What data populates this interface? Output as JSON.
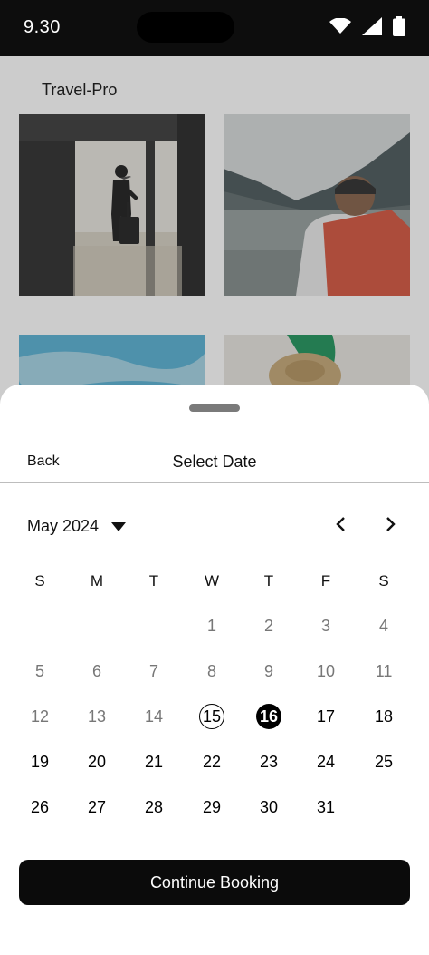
{
  "status_bar": {
    "time": "9.30",
    "icons": [
      "wifi-icon",
      "cellular-signal-icon",
      "battery-icon"
    ]
  },
  "background_app": {
    "title": "Travel-Pro",
    "photos": [
      "traveler-with-suitcase-silhouette",
      "hiker-with-backpack-lake",
      "blue-sky",
      "straw-hat-with-leaf"
    ]
  },
  "sheet": {
    "back_label": "Back",
    "title": "Select Date",
    "month_label": "May 2024",
    "weekdays": [
      "S",
      "M",
      "T",
      "W",
      "T",
      "F",
      "S"
    ],
    "weeks": [
      [
        "",
        "",
        "",
        "1",
        "2",
        "3",
        "4"
      ],
      [
        "5",
        "6",
        "7",
        "8",
        "9",
        "10",
        "11"
      ],
      [
        "12",
        "13",
        "14",
        "15",
        "16",
        "17",
        "18"
      ],
      [
        "19",
        "20",
        "21",
        "22",
        "23",
        "24",
        "25"
      ],
      [
        "26",
        "27",
        "28",
        "29",
        "30",
        "31",
        ""
      ]
    ],
    "today_day": "15",
    "selected_day": "16",
    "last_past_day": 14,
    "continue_label": "Continue Booking"
  },
  "colors": {
    "primary": "#000000",
    "past_day_text": "#777777",
    "overlay": "rgba(0,0,0,0.2)"
  }
}
